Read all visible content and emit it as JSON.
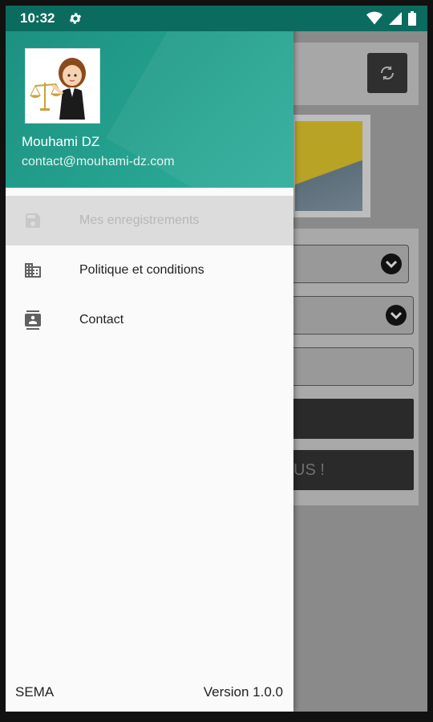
{
  "status_bar": {
    "time": "10:32",
    "icons": [
      "settings-gear-icon",
      "wifi-icon",
      "signal-icon",
      "battery-icon"
    ]
  },
  "drawer": {
    "user_name": "Mouhami DZ",
    "user_email": "contact@mouhami-dz.com",
    "avatar_icon": "lawyer-with-scales-avatar",
    "header_color": "#24a08e",
    "items": [
      {
        "label": "Mes enregistrements",
        "icon": "save-icon",
        "active": true
      },
      {
        "label": "Politique et conditions",
        "icon": "building-icon",
        "active": false
      },
      {
        "label": "Contact",
        "icon": "contact-card-icon",
        "active": false
      }
    ],
    "footer_left": "SEMA",
    "footer_right": "Version 1.0.0"
  },
  "background_app": {
    "partial_button_text": "US !",
    "refresh_icon": "refresh-icon",
    "dropdown_icon": "chevron-down-icon"
  }
}
